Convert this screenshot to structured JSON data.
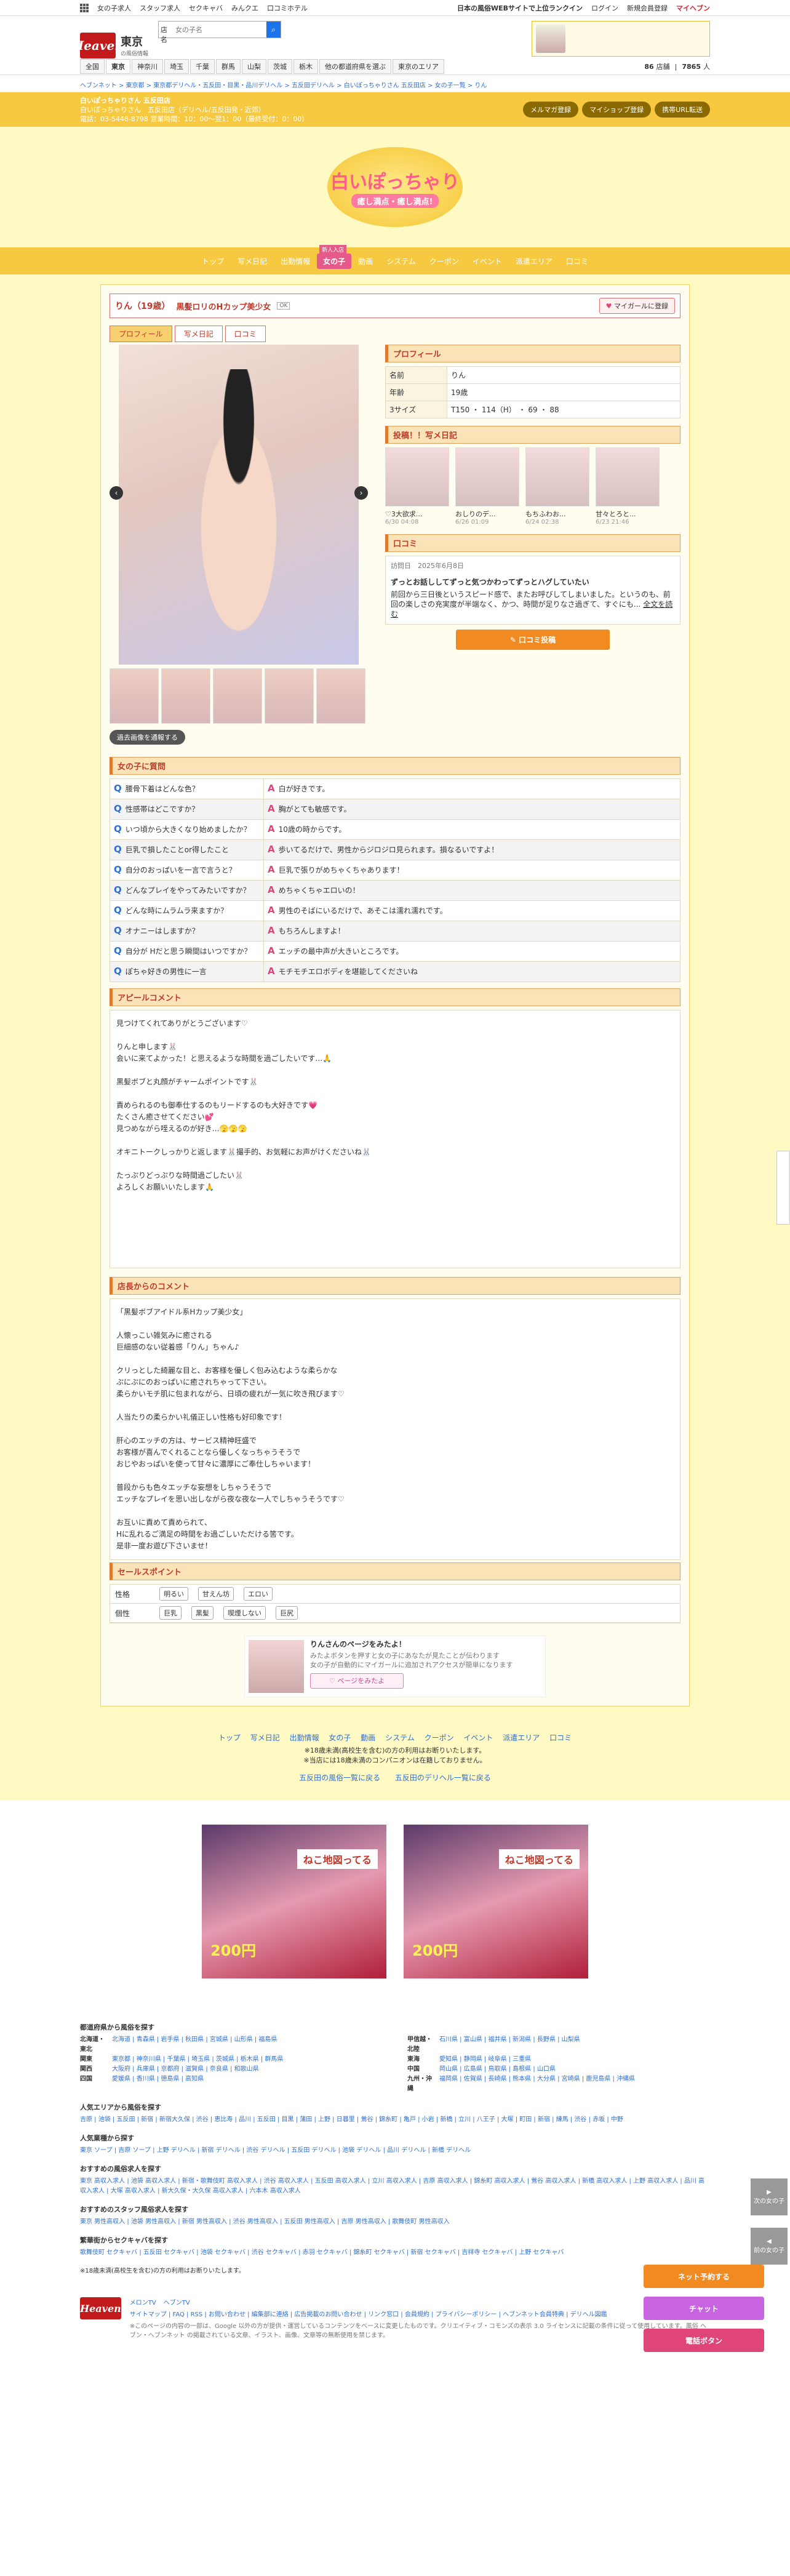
{
  "topbar": {
    "links": [
      "女の子求人",
      "スタッフ求人",
      "セクキャバ",
      "みんクエ",
      "口コミホテル"
    ],
    "right": [
      "日本の風俗WEBサイトで上位ランクイン",
      "ログイン",
      "新規会員登録",
      "マイヘブン"
    ]
  },
  "header": {
    "site": "Heaven",
    "region": "東京",
    "region_sub": "の風俗情報",
    "search_label": "店名",
    "search_placeholder": "女の子名",
    "stats": [
      "86",
      "店舗",
      "7865",
      "人"
    ]
  },
  "areas": [
    "全国",
    "東京",
    "神奈川",
    "埼玉",
    "千葉",
    "群馬",
    "山梨",
    "茨城",
    "栃木",
    "他の都道府県を選ぶ",
    "東京のエリア"
  ],
  "breadcrumb": "ヘブンネット > 東京都 > 東京都デリヘル・五反田・目黒・品川デリヘル > 五反田デリヘル > 白いぽっちゃりさん 五反田店 > 女の子一覧 > りん",
  "shop": {
    "name": "白いぽっちゃりさん 五反田店",
    "info1": "白いぽっちゃりさん　五反田店（デリヘル/五反田発・近郊）",
    "info2": "電話：03-5448-8798 営業時間：10：00〜翌1：00（最終受付：0：00）",
    "buttons": [
      "メルマガ登録",
      "マイショップ登録",
      "携帯URL転送"
    ],
    "hero_title": "白いぽっちゃり",
    "hero_tag": "癒し満点・癒し満点!"
  },
  "nav": {
    "items": [
      "トップ",
      "写メ日記",
      "出勤情報",
      "女の子",
      "動画",
      "システム",
      "クーポン",
      "イベント",
      "派遣エリア",
      "口コミ"
    ],
    "new_badge": "新人入店"
  },
  "girl": {
    "name": "りん（19歳）",
    "catch": "黒髪ロリのHカップ美少女",
    "tag": "OK",
    "fav": "マイガールに登録",
    "tabs": [
      "プロフィール",
      "写メ日記",
      "口コミ"
    ],
    "gallery_btn": "過去画像を通報する"
  },
  "profile": {
    "title": "プロフィール",
    "rows": [
      {
        "k": "名前",
        "v": "りん"
      },
      {
        "k": "年齢",
        "v": "19歳"
      },
      {
        "k": "3サイズ",
        "v": "T150 ・ 114（H） ・ 69 ・ 88"
      }
    ]
  },
  "diary": {
    "title": "投稿！！写メ日記",
    "items": [
      {
        "t": "♡3大欲求...",
        "d": "6/30 04:08"
      },
      {
        "t": "おしりのデ...",
        "d": "6/26 01:09"
      },
      {
        "t": "もちふわお...",
        "d": "6/24 02:38"
      },
      {
        "t": "甘々とろと...",
        "d": "6/23 21:46"
      }
    ]
  },
  "review": {
    "title": "口コミ",
    "date": "訪問日　2025年6月8日",
    "headline": "ずっとお話ししてずっと気つかわってずっとハグしていたい",
    "body": "前回から三日後というスピード感で、またお呼びしてしまいました。というのも、前回の楽しさの充実度が半端なく、かつ、時間が足りなさ過ぎて、すぐにも...",
    "more": "全文を読む",
    "button": "✎ 口コミ投稿"
  },
  "qa": {
    "title": "女の子に質問",
    "items": [
      {
        "q": "腰骨下着はどんな色？",
        "a": "白が好きです。"
      },
      {
        "q": "性感帯はどこですか？",
        "a": "胸がとても敏感です。"
      },
      {
        "q": "いつ頃から大きくなり始めましたか？",
        "a": "10歳の時からです。"
      },
      {
        "q": "巨乳で損したことor得したこと",
        "a": "歩いてるだけで、男性からジロジロ見られます。損なるいですよ！"
      },
      {
        "q": "自分のおっぱいを一言で言うと？",
        "a": "巨乳で張りがめちゃくちゃあります！"
      },
      {
        "q": "どんなプレイをやってみたいですか？",
        "a": "めちゃくちゃエロいの！"
      },
      {
        "q": "どんな時にムラムラ来ますか？",
        "a": "男性のそばにいるだけで、あそこは濡れ濡れです。"
      },
      {
        "q": "オナニーはしますか？",
        "a": "もちろんしますよ！"
      },
      {
        "q": "自分が Hだと思う瞬間はいつですか？",
        "a": "エッチの最中声が大きいところです。"
      },
      {
        "q": "ぽちゃ好きの男性に一言",
        "a": "モチモチエロボディを堪能してくださいね"
      }
    ]
  },
  "appeal": {
    "title": "アピールコメント",
    "text": "見つけてくれてありがとうございます♡\n\nりんと申します🐰\n会いに来てよかった！と思えるような時間を過ごしたいです…🙏\n\n黒髪ボブと丸顔がチャームポイントです🐰\n\n責められるのも御奉仕するのもリードするのも大好きです💗\nたくさん癒させてください💕\n見つめながら咥えるのが好き…🫣🫣🫣\n\nオキニトークしっかりと返します🐰撮手的、お気軽にお声がけくださいね🐰\n\nたっぷりどっぷりな時間過ごしたい🐰\nよろしくお願いいたします🙏"
  },
  "shop_comment": {
    "title": "店長からのコメント",
    "text": "「黒髪ボブアイドル系Hカップ美少女」\n\n人懐っこい雑気みに癒される\n巨細感のない従着感「りん」ちゃん♪\n\nクリっとした綺麗な目と、お客様を優しく包み込むような柔らかな\nぷにぷにのおっぱいに癒されちゃって下さい。\n柔らかいモチ肌に包まれながら、日頃の疲れが一気に吹き飛びます♡\n\n人当たりの柔らかい礼儀正しい性格も好印象です！\n\n肝心のエッチの方は、サービス精神旺盛で\nお客様が喜んでくれることなら優しくなっちゃうそうで\nおじやおっぱいを使って甘々に濃厚にご奉仕しちゃいます！\n\n普段からも色々エッチな妄想をしちゃうそうで\nエッチなプレイを思い出しながら夜な夜な一人でしちゃうそうです♡\n\nお互いに責めて責められて、\nHに乱れるご満足の時間をお過ごしいただける筈です。\n是非一度お遊び下さいませ！"
  },
  "sales": {
    "title": "セールスポイント",
    "rows": [
      {
        "k": "性格",
        "chips": [
          "明るい",
          "甘えん坊",
          "エロい"
        ]
      },
      {
        "k": "個性",
        "chips": [
          "巨乳",
          "黒髪",
          "喫煙しない",
          "巨尻"
        ]
      }
    ]
  },
  "mypage": {
    "title": "りんさんのページをみたよ！",
    "body": "みたよボタンを押すと女の子にあなたが見たことが伝わります\n女の子が自動的にマイガールに追加されアクセスが簡単になります",
    "button": "♡ ページをみたよ"
  },
  "footnav": {
    "links": [
      "トップ",
      "写メ日記",
      "出勤情報",
      "女の子",
      "動画",
      "システム",
      "クーポン",
      "イベント",
      "派遣エリア",
      "口コミ"
    ],
    "notes": [
      "※18歳未満(高校生を含む)の方の利用はお断りいたします。",
      "※当店には18歳未満のコンパニオンは在籍しておりません。"
    ],
    "sub": [
      "五反田の風俗一覧に戻る",
      "五反田のデリヘル一覧に戻る"
    ]
  },
  "ads": [
    {
      "cap": "ねこ地図ってる",
      "cap2": "200円"
    },
    {
      "cap": "ねこ地図ってる",
      "cap2": "200円"
    }
  ],
  "links": {
    "pref_title": "都道府県から風俗を探す",
    "pref_left": [
      {
        "k": "北海道・東北",
        "v": "北海道 | 青森県 | 岩手県 | 秋田県 | 宮城県 | 山形県 | 福島県"
      },
      {
        "k": "関東",
        "v": "東京都 | 神奈川県 | 千葉県 | 埼玉県 | 茨城県 | 栃木県 | 群馬県"
      },
      {
        "k": "関西",
        "v": "大阪府 | 兵庫県 | 京都府 | 滋賀県 | 奈良県 | 和歌山県"
      },
      {
        "k": "四国",
        "v": "愛媛県 | 香川県 | 徳島県 | 高知県"
      }
    ],
    "pref_right": [
      {
        "k": "甲信越・北陸",
        "v": "石川県 | 富山県 | 福井県 | 新潟県 | 長野県 | 山梨県"
      },
      {
        "k": "東海",
        "v": "愛知県 | 静岡県 | 岐阜県 | 三重県"
      },
      {
        "k": "中国",
        "v": "岡山県 | 広島県 | 鳥取県 | 島根県 | 山口県"
      },
      {
        "k": "九州・沖縄",
        "v": "福岡県 | 佐賀県 | 長崎県 | 熊本県 | 大分県 | 宮崎県 | 鹿児島県 | 沖縄県"
      }
    ],
    "sections": [
      {
        "h": "人気エリアから風俗を探す",
        "v": "吉原 | 池袋 | 五反田 | 新宿 | 新宿大久保 | 渋谷 | 恵比寿 | 品川 | 五反田 | 目黒 | 蒲田 | 上野 | 日暮里 | 鶯谷 | 錦糸町 | 亀戸 | 小岩 | 新橋 | 立川 | 八王子 | 大塚 | 町田 | 新宿 | 練馬 | 渋谷 | 赤坂 | 中野"
      },
      {
        "h": "人気業種から探す",
        "v": "東京 ソープ | 吉原 ソープ | 上野 デリヘル | 新宿 デリヘル | 渋谷 デリヘル | 五反田 デリヘル | 池袋 デリヘル | 品川 デリヘル | 新橋 デリヘル"
      },
      {
        "h": "おすすめの風俗求人を探す",
        "v": "東京 高収入求人 | 池袋 高収入求人 | 新宿・歌舞伎町 高収入求人 | 渋谷 高収入求人 | 五反田 高収入求人 | 立川 高収入求人 | 吉原 高収入求人 | 錦糸町 高収入求人 | 鶯谷 高収入求人 | 新橋 高収入求人 | 上野 高収入求人 | 品川 高収入求人 | 大塚 高収入求人 | 新大久保・大久保 高収入求人 | 六本木 高収入求人"
      },
      {
        "h": "おすすめのスタッフ風俗求人を探す",
        "v": "東京 男性高収入 | 池袋 男性高収入 | 新宿 男性高収入 | 渋谷 男性高収入 | 五反田 男性高収入 | 吉原 男性高収入 | 歌舞伎町 男性高収入"
      },
      {
        "h": "繁華街からセクキャバを探す",
        "v": "歌舞伎町 セクキャバ | 五反田 セクキャバ | 池袋 セクキャバ | 渋谷 セクキャバ | 赤羽 セクキャバ | 錦糸町 セクキャバ | 新宿 セクキャバ | 吉祥寺 セクキャバ | 上野 セクキャバ"
      }
    ],
    "note": "※18歳未満(高校生を含む)の方の利用はお断りいたします。"
  },
  "footer": {
    "logo": "Heaven",
    "apps": [
      "メロンTV",
      "ヘブンTV"
    ],
    "links": "サイトマップ | FAQ | RSS | お問い合わせ | 編集部に連絡 | 広告掲載のお問い合わせ | リンク窓口 | 会員規約 | プライバシーポリシー | ヘブンネット会員特典 | デリヘル図鑑",
    "copy": "※このページの内容の一部は、Google 以外の方が提供・運営しているコンテンツをベースに変更したものです。クリエイティブ・コモンズの表示 3.0 ライセンスに記載の条件に従って使用しています。風俗 ヘブン・ヘブンネット の掲載されている文章、イラスト、画像、文章等の無断使用を禁じます。"
  },
  "float": {
    "buttons": [
      "ネット予約する",
      "チャット",
      "電話ボタン"
    ],
    "nav": [
      "次の女の子",
      "前の女の子"
    ]
  }
}
